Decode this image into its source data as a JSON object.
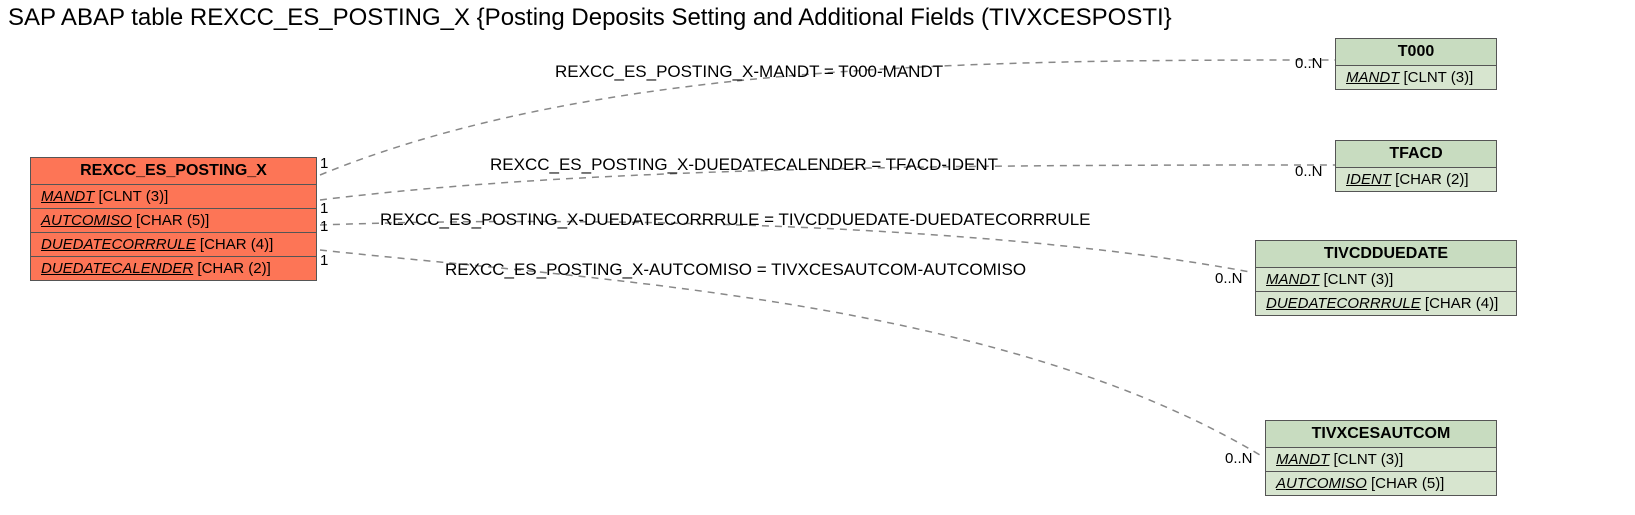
{
  "title": "SAP ABAP table REXCC_ES_POSTING_X {Posting Deposits Setting and Additional Fields (TIVXCESPOSTI}",
  "main_entity": {
    "name": "REXCC_ES_POSTING_X",
    "fields": [
      {
        "name": "MANDT",
        "type": "[CLNT (3)]"
      },
      {
        "name": "AUTCOMISO",
        "type": "[CHAR (5)]"
      },
      {
        "name": "DUEDATECORRRULE",
        "type": "[CHAR (4)]"
      },
      {
        "name": "DUEDATECALENDER",
        "type": "[CHAR (2)]"
      }
    ]
  },
  "targets": [
    {
      "name": "T000",
      "fields": [
        {
          "name": "MANDT",
          "type": "[CLNT (3)]"
        }
      ]
    },
    {
      "name": "TFACD",
      "fields": [
        {
          "name": "IDENT",
          "type": "[CHAR (2)]"
        }
      ]
    },
    {
      "name": "TIVCDDUEDATE",
      "fields": [
        {
          "name": "MANDT",
          "type": "[CLNT (3)]"
        },
        {
          "name": "DUEDATECORRRULE",
          "type": "[CHAR (4)]"
        }
      ]
    },
    {
      "name": "TIVXCESAUTCOM",
      "fields": [
        {
          "name": "MANDT",
          "type": "[CLNT (3)]"
        },
        {
          "name": "AUTCOMISO",
          "type": "[CHAR (5)]"
        }
      ]
    }
  ],
  "relations": [
    {
      "label": "REXCC_ES_POSTING_X-MANDT = T000-MANDT",
      "left_card": "1",
      "right_card": "0..N"
    },
    {
      "label": "REXCC_ES_POSTING_X-DUEDATECALENDER = TFACD-IDENT",
      "left_card": "1",
      "right_card": "0..N"
    },
    {
      "label": "REXCC_ES_POSTING_X-DUEDATECORRRULE = TIVCDDUEDATE-DUEDATECORRRULE",
      "left_card": "1",
      "right_card": "0..N"
    },
    {
      "label": "REXCC_ES_POSTING_X-AUTCOMISO = TIVXCESAUTCOM-AUTCOMISO",
      "left_card": "1",
      "right_card": "0..N"
    }
  ],
  "chart_data": {
    "type": "table",
    "title": "Entity-relationship diagram for SAP table REXCC_ES_POSTING_X",
    "source_entity": "REXCC_ES_POSTING_X",
    "source_fields": [
      "MANDT CLNT(3)",
      "AUTCOMISO CHAR(5)",
      "DUEDATECORRRULE CHAR(4)",
      "DUEDATECALENDER CHAR(2)"
    ],
    "relationships": [
      {
        "from": "REXCC_ES_POSTING_X.MANDT",
        "to": "T000.MANDT",
        "cardinality": "1 to 0..N"
      },
      {
        "from": "REXCC_ES_POSTING_X.DUEDATECALENDER",
        "to": "TFACD.IDENT",
        "cardinality": "1 to 0..N"
      },
      {
        "from": "REXCC_ES_POSTING_X.DUEDATECORRRULE",
        "to": "TIVCDDUEDATE.DUEDATECORRRULE",
        "cardinality": "1 to 0..N"
      },
      {
        "from": "REXCC_ES_POSTING_X.AUTCOMISO",
        "to": "TIVXCESAUTCOM.AUTCOMISO",
        "cardinality": "1 to 0..N"
      }
    ]
  }
}
